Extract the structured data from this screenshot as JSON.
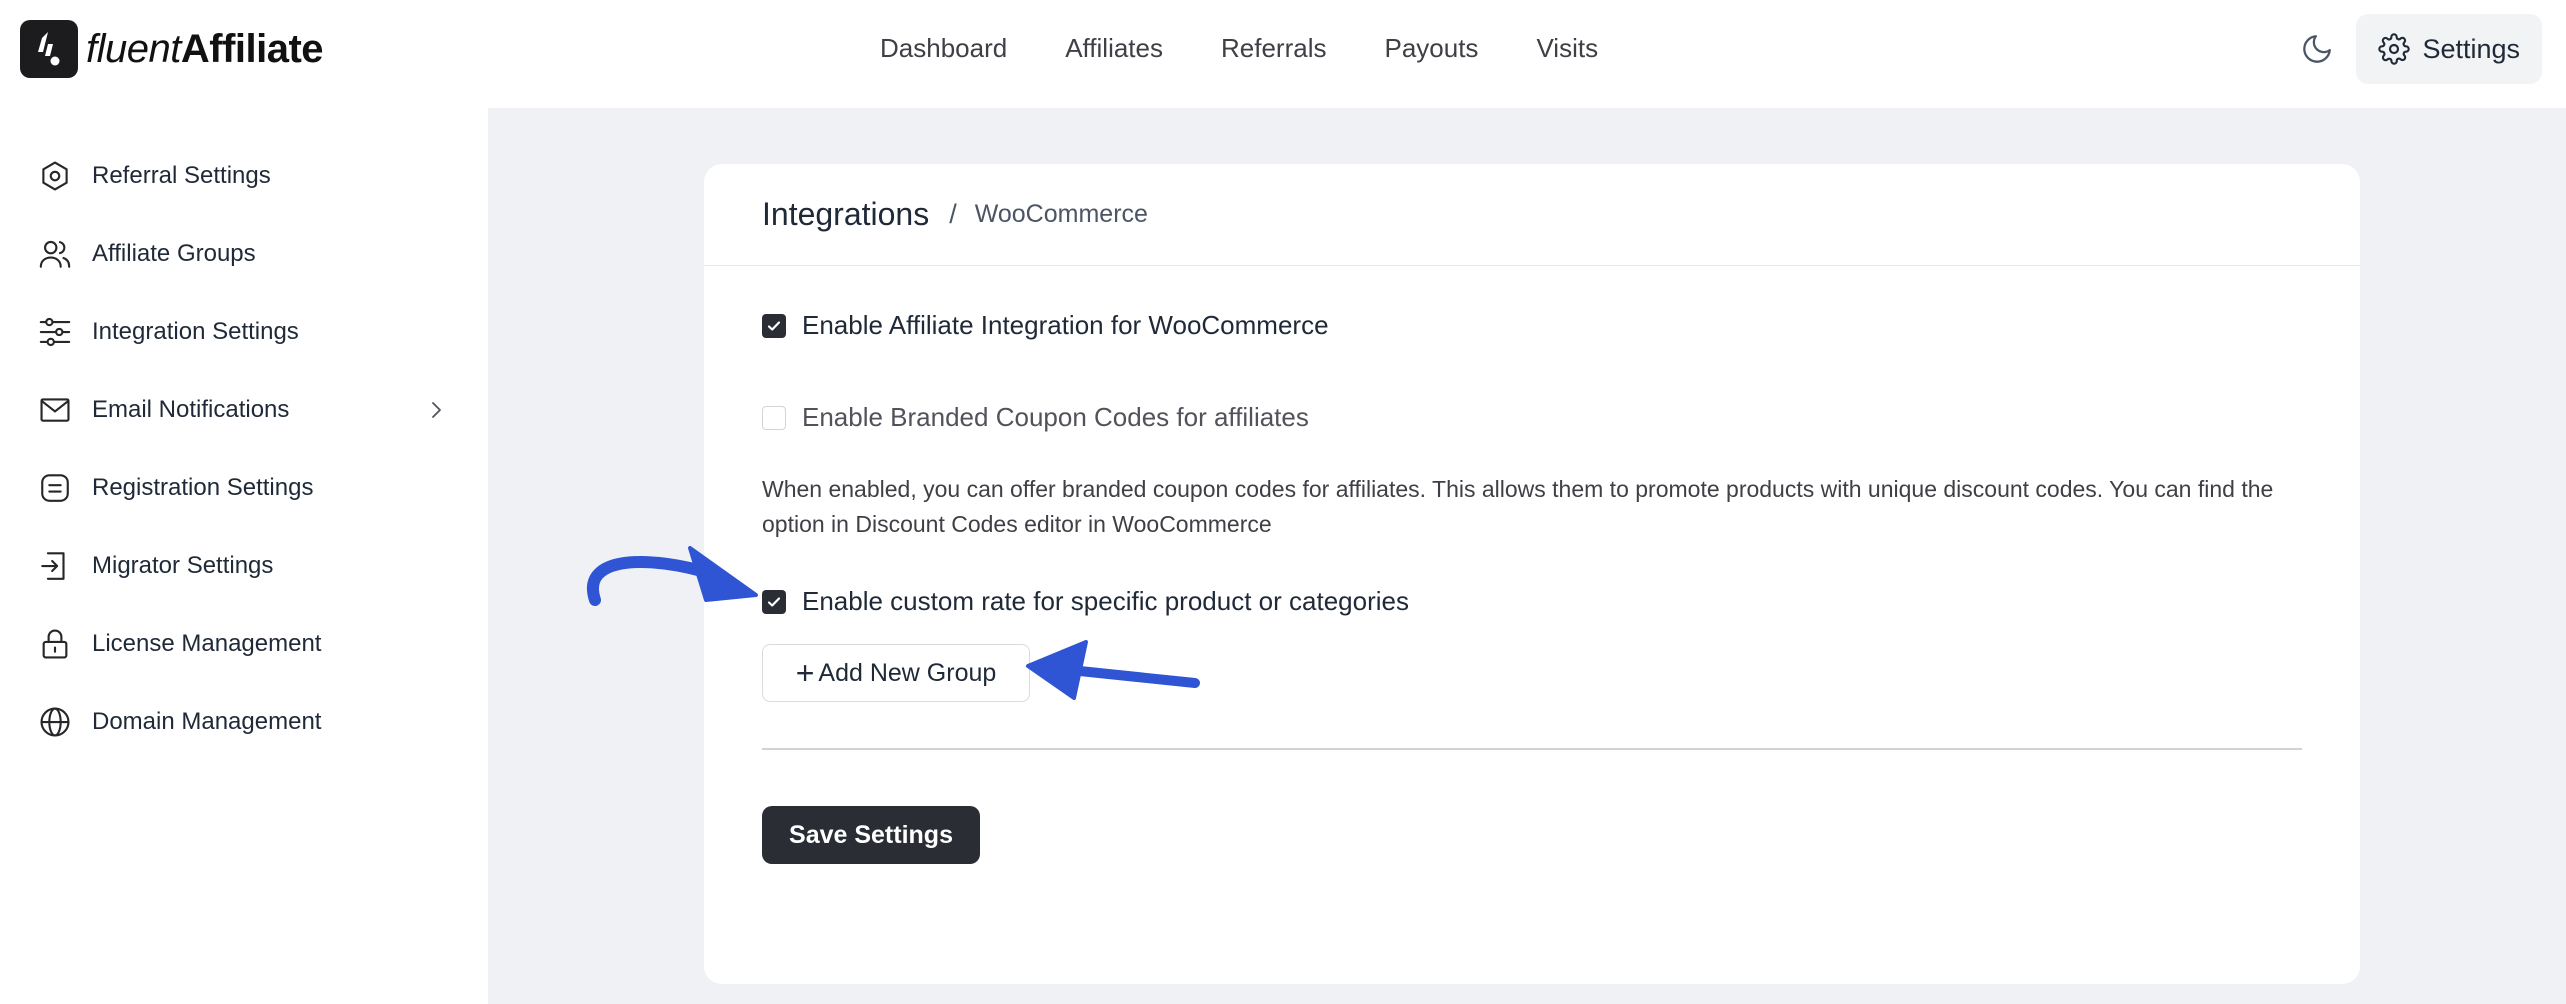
{
  "brand": {
    "light": "fluent",
    "bold": "Affiliate"
  },
  "nav": [
    "Dashboard",
    "Affiliates",
    "Referrals",
    "Payouts",
    "Visits"
  ],
  "header": {
    "settings_label": "Settings"
  },
  "sidebar": {
    "items": [
      {
        "label": "Referral Settings",
        "icon": "hexagon-gear-icon"
      },
      {
        "label": "Affiliate Groups",
        "icon": "users-icon"
      },
      {
        "label": "Integration Settings",
        "icon": "sliders-icon"
      },
      {
        "label": "Email Notifications",
        "icon": "mail-icon",
        "has_submenu": true
      },
      {
        "label": "Registration Settings",
        "icon": "form-icon"
      },
      {
        "label": "Migrator Settings",
        "icon": "import-icon"
      },
      {
        "label": "License Management",
        "icon": "lock-icon"
      },
      {
        "label": "Domain Management",
        "icon": "globe-icon"
      }
    ]
  },
  "breadcrumb": {
    "main": "Integrations",
    "separator": "/",
    "current": "WooCommerce"
  },
  "options": {
    "enable_integration": {
      "label": "Enable Affiliate Integration for WooCommerce",
      "checked": true
    },
    "branded_coupons": {
      "label": "Enable Branded Coupon Codes for affiliates",
      "checked": false
    },
    "branded_description": "When enabled, you can offer branded coupon codes for affiliates. This allows them to promote products with unique discount codes. You can find the option in Discount Codes editor in WooCommerce",
    "custom_rate": {
      "label": "Enable custom rate for specific product or categories",
      "checked": true
    }
  },
  "buttons": {
    "add_group": "Add New Group",
    "add_group_icon": "+",
    "save": "Save Settings"
  },
  "colors": {
    "accent_dark": "#2a2d34",
    "content_bg": "#eff1f4",
    "annotation_arrow": "#2f55d4"
  }
}
